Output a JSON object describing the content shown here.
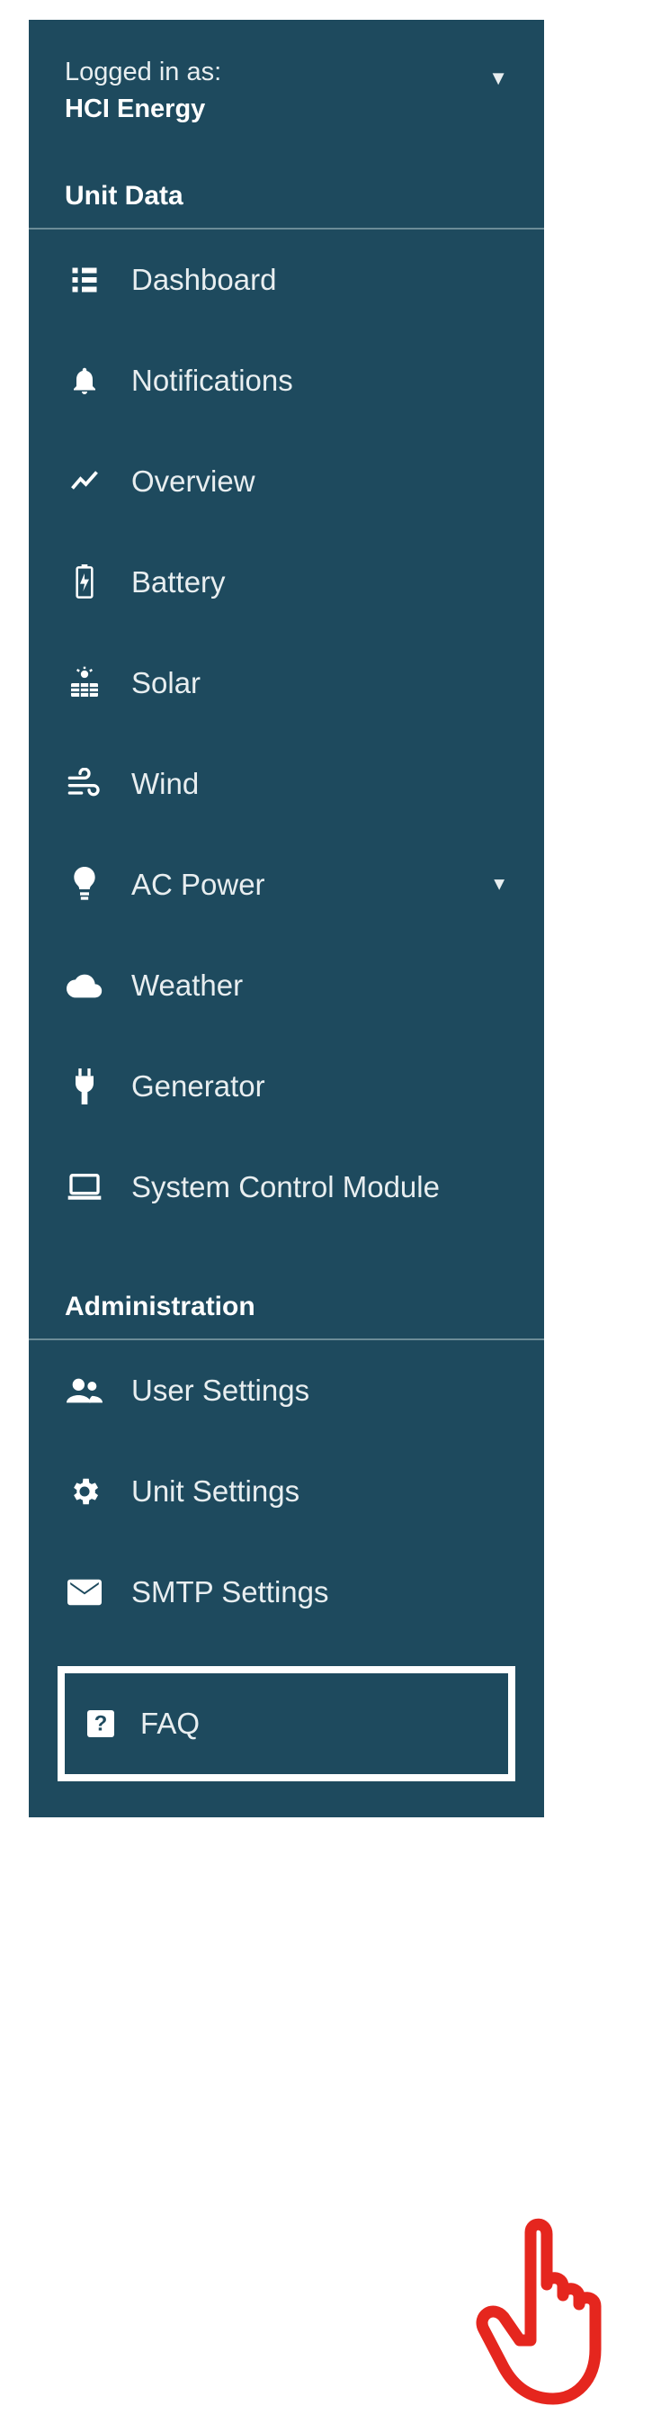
{
  "login": {
    "caption": "Logged in as:",
    "user": "HCI Energy"
  },
  "sections": {
    "unit_data": "Unit Data",
    "administration": "Administration"
  },
  "unit_items": [
    {
      "label": "Dashboard"
    },
    {
      "label": "Notifications"
    },
    {
      "label": "Overview"
    },
    {
      "label": "Battery"
    },
    {
      "label": "Solar"
    },
    {
      "label": "Wind"
    },
    {
      "label": "AC Power"
    },
    {
      "label": "Weather"
    },
    {
      "label": "Generator"
    },
    {
      "label": "System Control Module"
    }
  ],
  "admin_items": [
    {
      "label": "User Settings"
    },
    {
      "label": "Unit Settings"
    },
    {
      "label": "SMTP Settings"
    },
    {
      "label": "FAQ"
    }
  ]
}
